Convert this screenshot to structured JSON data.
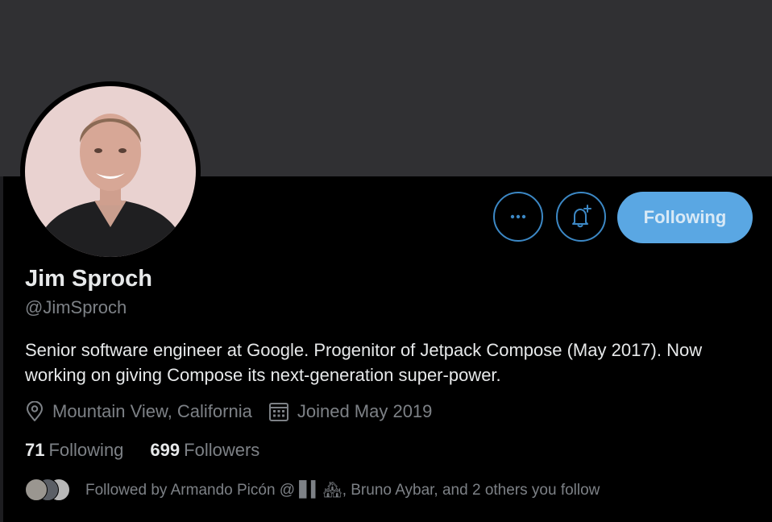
{
  "profile": {
    "name": "Jim Sproch",
    "handle": "@JimSproch",
    "bio": "Senior software engineer at Google. Progenitor of Jetpack Compose (May 2017). Now working on giving Compose its next-generation super-power.",
    "location": "Mountain View, California",
    "joined": "Joined May 2019"
  },
  "actions": {
    "more_icon": "more-horizontal-icon",
    "notify_icon": "bell-plus-icon",
    "follow_label": "Following"
  },
  "stats": {
    "following_count": "71",
    "following_label": "Following",
    "followers_count": "699",
    "followers_label": "Followers"
  },
  "followed_by": {
    "text": "Followed by Armando Picón @ ▋▍🏘, Bruno Aybar, and 2 others you follow"
  },
  "colors": {
    "accent": "#3c88c5",
    "follow_button_bg": "#5aa7e3",
    "banner": "#303033",
    "background": "#000000",
    "text_primary": "#e7e9ea",
    "text_secondary": "#7d8186"
  }
}
